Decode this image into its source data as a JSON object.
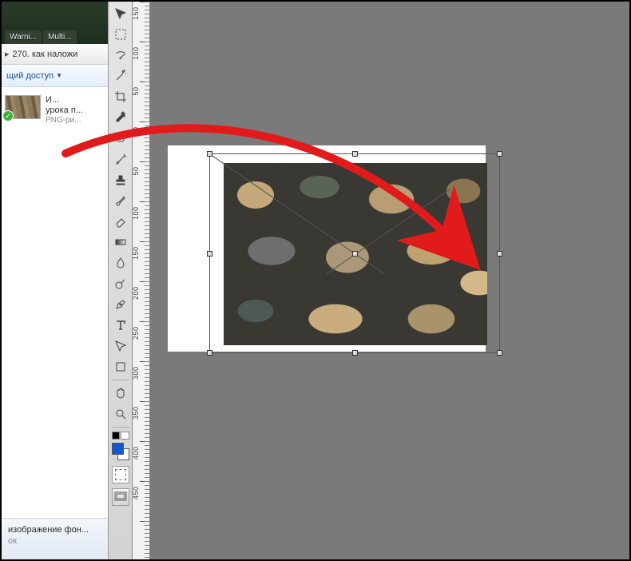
{
  "explorer": {
    "tabs": [
      "Warni...",
      "Multi..."
    ],
    "breadcrumb_label": "270. как наложи",
    "share_label": "щий доступ",
    "file": {
      "line1": "И...",
      "line2": "урока п...",
      "type": "PNG-ри..."
    },
    "footer_line1": "изображение фон...",
    "footer_line2": "ок"
  },
  "ruler": {
    "labels": [
      "1\n5\n0",
      "1\n0\n0",
      "5\n0",
      "0",
      "5\n0",
      "1\n0\n0",
      "1\n5\n0",
      "2\n0\n0",
      "2\n5\n0",
      "3\n0\n0",
      "3\n5\n0",
      "4\n0\n0",
      "4\n5\n0"
    ]
  },
  "colors": {
    "foreground": "#1556d6",
    "arrow": "#e11b1b"
  }
}
